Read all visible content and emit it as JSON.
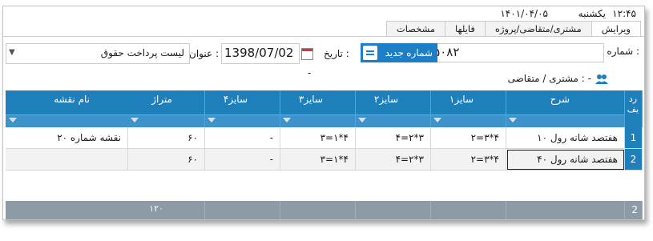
{
  "header": {
    "time": "۱۲:۴۵",
    "day": "یکشنبه",
    "date": "۱۴۰۱/۰۴/۰۵"
  },
  "tabs": [
    {
      "label": "ویرایش",
      "active": true
    },
    {
      "label": "مشتری/متقاضی/پروژه",
      "active": false
    },
    {
      "label": "فایلها",
      "active": false
    },
    {
      "label": "مشخصات",
      "active": false
    }
  ],
  "form": {
    "number_label": "شماره :",
    "number_value": "۹۸۰۵۰۸۲",
    "new_number_button": "شماره جدید",
    "date_label": "تاریخ :",
    "date_value": "1398/07/02",
    "title_label": "عنوان :",
    "title_value": "لیست پرداخت حقوق",
    "customer_label": "مشتری / متقاضی : -",
    "customer_value": "-"
  },
  "grid": {
    "columns": [
      "رد یف",
      "شرح",
      "سایز۱",
      "سایز۲",
      "سایز۳",
      "سایز۴",
      "متراژ",
      "نام نقشه"
    ],
    "rows": [
      [
        "1",
        "هفتصد شانه رول ۱۰",
        "۲=۳*۴",
        "۴=۲*۳",
        "۳=۱*۴",
        "-",
        "۶۰",
        "نقشه شماره ۲۰"
      ],
      [
        "2",
        "هفتصد شانه رول ۴۰",
        "۲=۳*۴",
        "۴=۲*۳",
        "۳=۱*۴",
        "-",
        "۶۰",
        ""
      ]
    ],
    "footer": {
      "row_count": "2",
      "metraj_total": "۱۲۰"
    }
  },
  "colors": {
    "header_blue": "#1f7fba",
    "button_blue": "#1c7ec4",
    "footer_gray": "#8d9ba6"
  }
}
